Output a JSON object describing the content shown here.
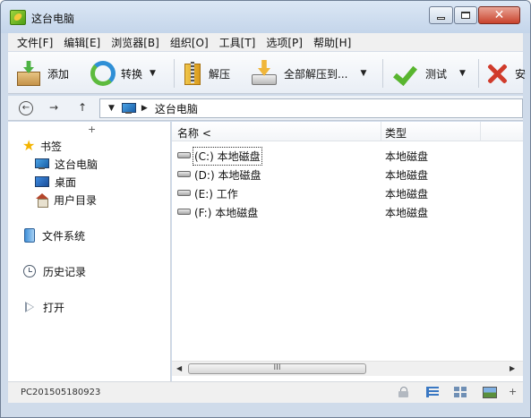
{
  "window": {
    "title": "这台电脑"
  },
  "menu": [
    "文件[F]",
    "编辑[E]",
    "浏览器[B]",
    "组织[O]",
    "工具[T]",
    "选项[P]",
    "帮助[H]"
  ],
  "toolbar": {
    "add_label": "添加",
    "convert_label": "转换",
    "extract_label": "解压",
    "extract_all_label": "全部解压到...",
    "test_label": "测试",
    "delete_label_partial": "安"
  },
  "address": {
    "path": "这台电脑"
  },
  "sidebar": {
    "bookmarks_label": "书签",
    "items": [
      {
        "label": "这台电脑",
        "icon": "monitor-icon"
      },
      {
        "label": "桌面",
        "icon": "desktop-icon"
      },
      {
        "label": "用户目录",
        "icon": "home-icon"
      }
    ],
    "filesystem_label": "文件系统",
    "history_label": "历史记录",
    "open_label": "打开"
  },
  "columns": {
    "name": "名称 <",
    "type": "类型"
  },
  "files": [
    {
      "name": "(C:) 本地磁盘",
      "type": "本地磁盘"
    },
    {
      "name": "(D:) 本地磁盘",
      "type": "本地磁盘"
    },
    {
      "name": "(E:) 工作",
      "type": "本地磁盘"
    },
    {
      "name": "(F:) 本地磁盘",
      "type": "本地磁盘"
    }
  ],
  "scrollbar": {
    "grip": "III"
  },
  "status": {
    "computer_name": "PC201505180923"
  },
  "colors": {
    "window_frame": "#cfdbea",
    "close_button": "#c9432c",
    "accent_blue": "#3a78c3"
  }
}
